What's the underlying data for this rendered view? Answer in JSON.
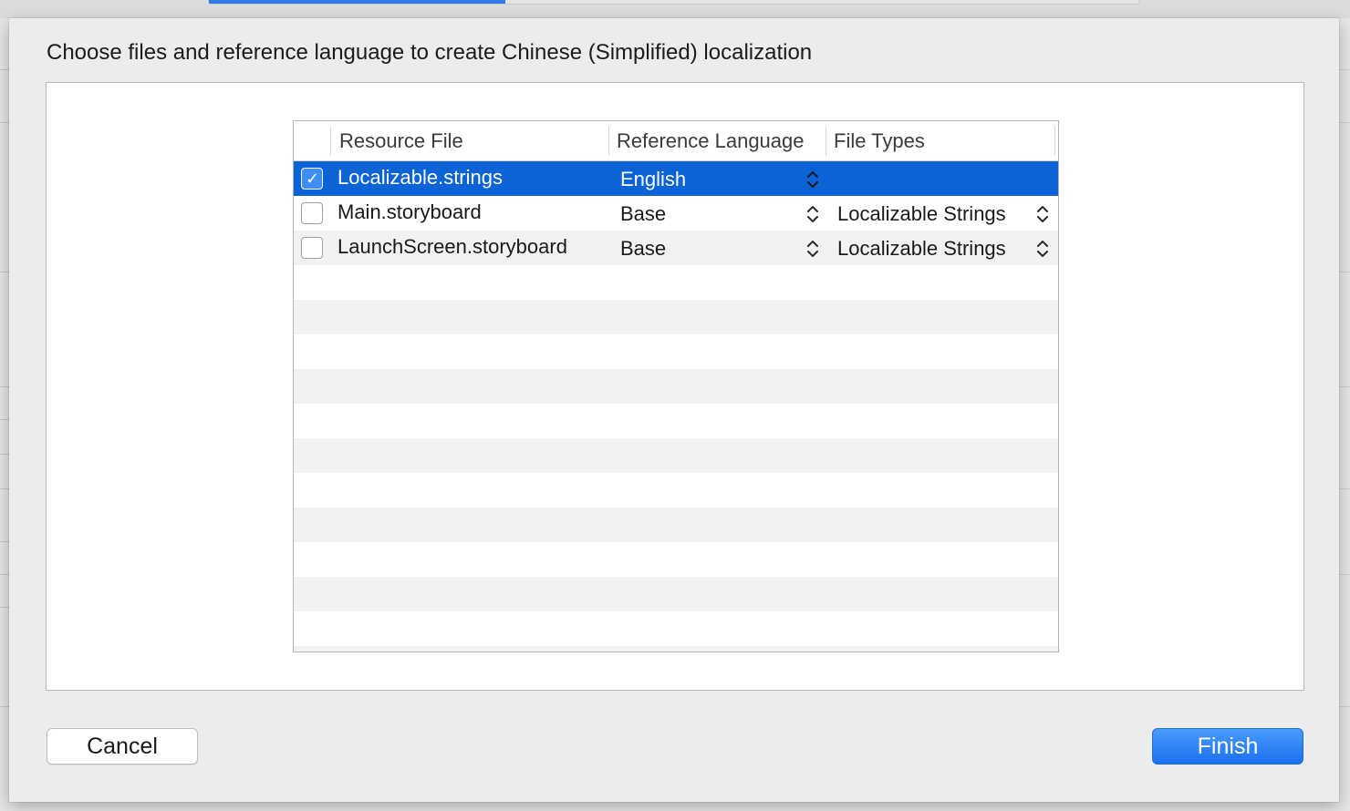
{
  "dialog": {
    "title": "Choose files and reference language to create Chinese (Simplified) localization"
  },
  "table": {
    "columns": [
      "Resource File",
      "Reference Language",
      "File Types"
    ],
    "rows": [
      {
        "checked": true,
        "file": "Localizable.strings",
        "language": "English",
        "file_type": "",
        "selected": true
      },
      {
        "checked": false,
        "file": "Main.storyboard",
        "language": "Base",
        "file_type": "Localizable Strings",
        "selected": false
      },
      {
        "checked": false,
        "file": "LaunchScreen.storyboard",
        "language": "Base",
        "file_type": "Localizable Strings",
        "selected": false
      }
    ]
  },
  "buttons": {
    "cancel": "Cancel",
    "finish": "Finish"
  },
  "colors": {
    "selection": "#0b63d6",
    "primary_button": "#1a6ff0",
    "checkbox_checked": "#3d8ff5"
  },
  "icons": {
    "checkmark": "checkmark-icon",
    "popup_stepper": "up-down-chevron-icon"
  }
}
